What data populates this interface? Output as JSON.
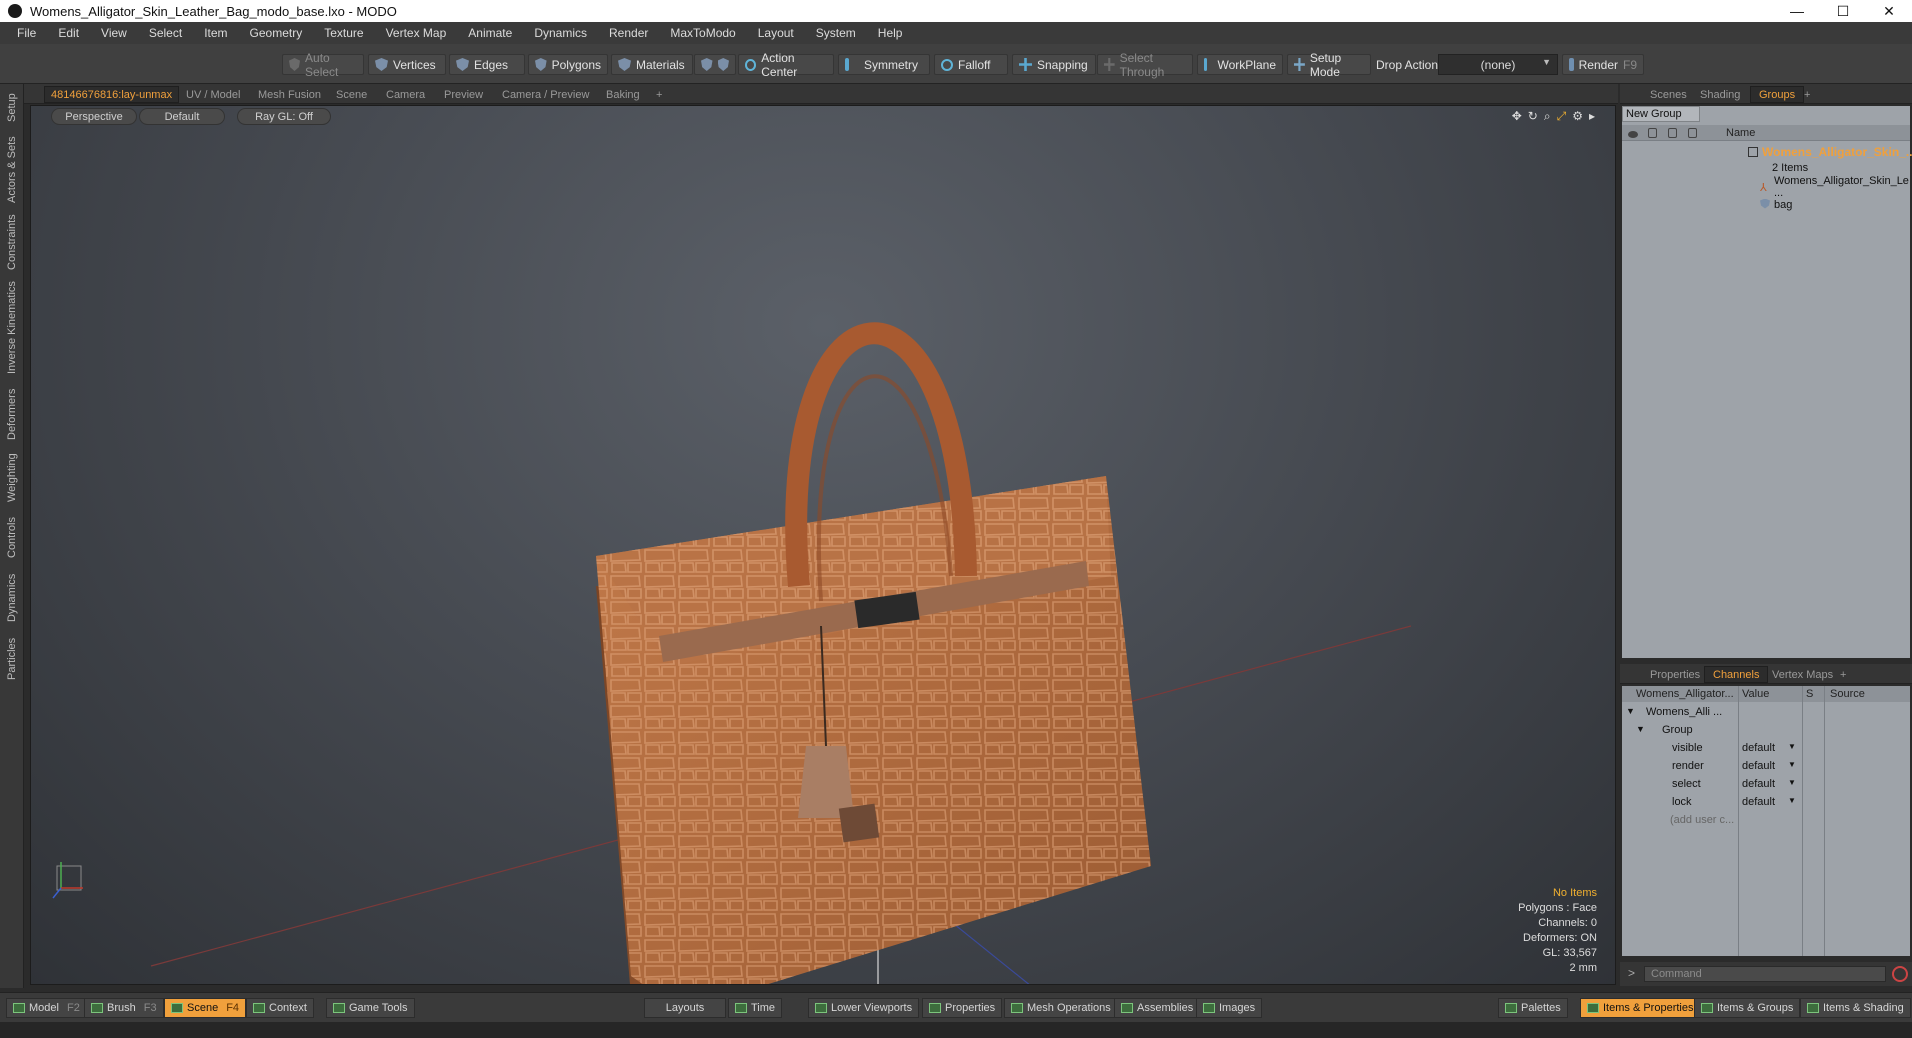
{
  "window": {
    "title": "Womens_Alligator_Skin_Leather_Bag_modo_base.lxo - MODO",
    "controls": [
      "—",
      "☐",
      "✕"
    ]
  },
  "menu": [
    "File",
    "Edit",
    "View",
    "Select",
    "Item",
    "Geometry",
    "Texture",
    "Vertex Map",
    "Animate",
    "Dynamics",
    "Render",
    "MaxToModo",
    "Layout",
    "System",
    "Help"
  ],
  "toolbar": {
    "auto_select": "Auto Select",
    "vertices": "Vertices",
    "edges": "Edges",
    "polygons": "Polygons",
    "materials": "Materials",
    "action_center": "Action Center",
    "symmetry": "Symmetry",
    "falloff": "Falloff",
    "snapping": "Snapping",
    "select_through": "Select Through",
    "workplane": "WorkPlane",
    "setup_mode": "Setup Mode",
    "drop_action": "Drop Action",
    "drop_action_value": "(none)",
    "render": "Render",
    "render_key": "F9"
  },
  "left_tabs": [
    "Setup",
    "Actors & Sets",
    "Constraints",
    "Inverse Kinematics",
    "Deformers",
    "Weighting",
    "Controls",
    "Dynamics",
    "Particles"
  ],
  "viewport_tabs": [
    "48146676816:lay-unmax",
    "UV / Model",
    "Mesh Fusion",
    "Scene",
    "Camera",
    "Preview",
    "Camera / Preview",
    "Baking",
    "+"
  ],
  "viewport": {
    "view_mode": "Perspective",
    "shading": "Default",
    "raygl": "Ray GL: Off",
    "info": {
      "items": "No Items",
      "polygons": "Polygons : Face",
      "channels": "Channels: 0",
      "deformers": "Deformers: ON",
      "gl": "GL: 33,567",
      "unit": "2 mm"
    }
  },
  "right_tabs": [
    "Scenes",
    "Shading",
    "Groups",
    "+"
  ],
  "groups": {
    "new_group": "New Group",
    "name_header": "Name",
    "group_name": "Womens_Alligator_Skin_...",
    "group_count": "2 Items",
    "children": [
      "Womens_Alligator_Skin_Le ...",
      "bag"
    ]
  },
  "channel_tabs": [
    "Properties",
    "Channels",
    "Vertex Maps",
    "+"
  ],
  "channels": {
    "headers": [
      "Womens_Alligator...",
      "Value",
      "S",
      "Source"
    ],
    "item": "Womens_Alli ...",
    "group": "Group",
    "rows": [
      {
        "name": "visible",
        "value": "default"
      },
      {
        "name": "render",
        "value": "default"
      },
      {
        "name": "select",
        "value": "default"
      },
      {
        "name": "lock",
        "value": "default"
      }
    ],
    "add_user": "(add user c..."
  },
  "command": {
    "placeholder": "Command"
  },
  "bottom": {
    "model": "Model",
    "model_key": "F2",
    "brush": "Brush",
    "brush_key": "F3",
    "scene": "Scene",
    "scene_key": "F4",
    "context": "Context",
    "game_tools": "Game Tools",
    "layouts": "Layouts",
    "time": "Time",
    "lower_viewports": "Lower Viewports",
    "properties": "Properties",
    "mesh_operations": "Mesh Operations",
    "assemblies": "Assemblies",
    "images": "Images",
    "palettes": "Palettes",
    "items_properties": "Items & Properties",
    "items_groups": "Items & Groups",
    "items_shading": "Items & Shading"
  },
  "colors": {
    "accent": "#f0a03c",
    "leather": "#b06a3e",
    "handle": "#a85a30"
  }
}
